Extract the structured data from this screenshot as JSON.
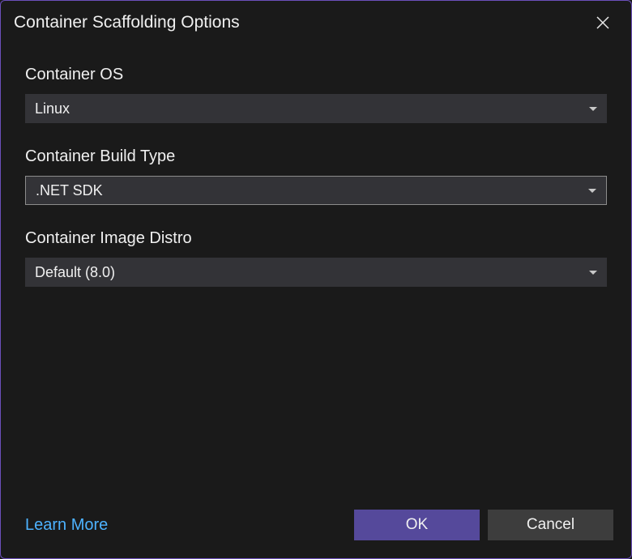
{
  "dialog": {
    "title": "Container Scaffolding Options"
  },
  "fields": {
    "containerOS": {
      "label": "Container OS",
      "value": "Linux"
    },
    "containerBuildType": {
      "label": "Container Build Type",
      "value": ".NET SDK"
    },
    "containerImageDistro": {
      "label": "Container Image Distro",
      "value": "Default (8.0)"
    }
  },
  "footer": {
    "learnMore": "Learn More",
    "ok": "OK",
    "cancel": "Cancel"
  }
}
